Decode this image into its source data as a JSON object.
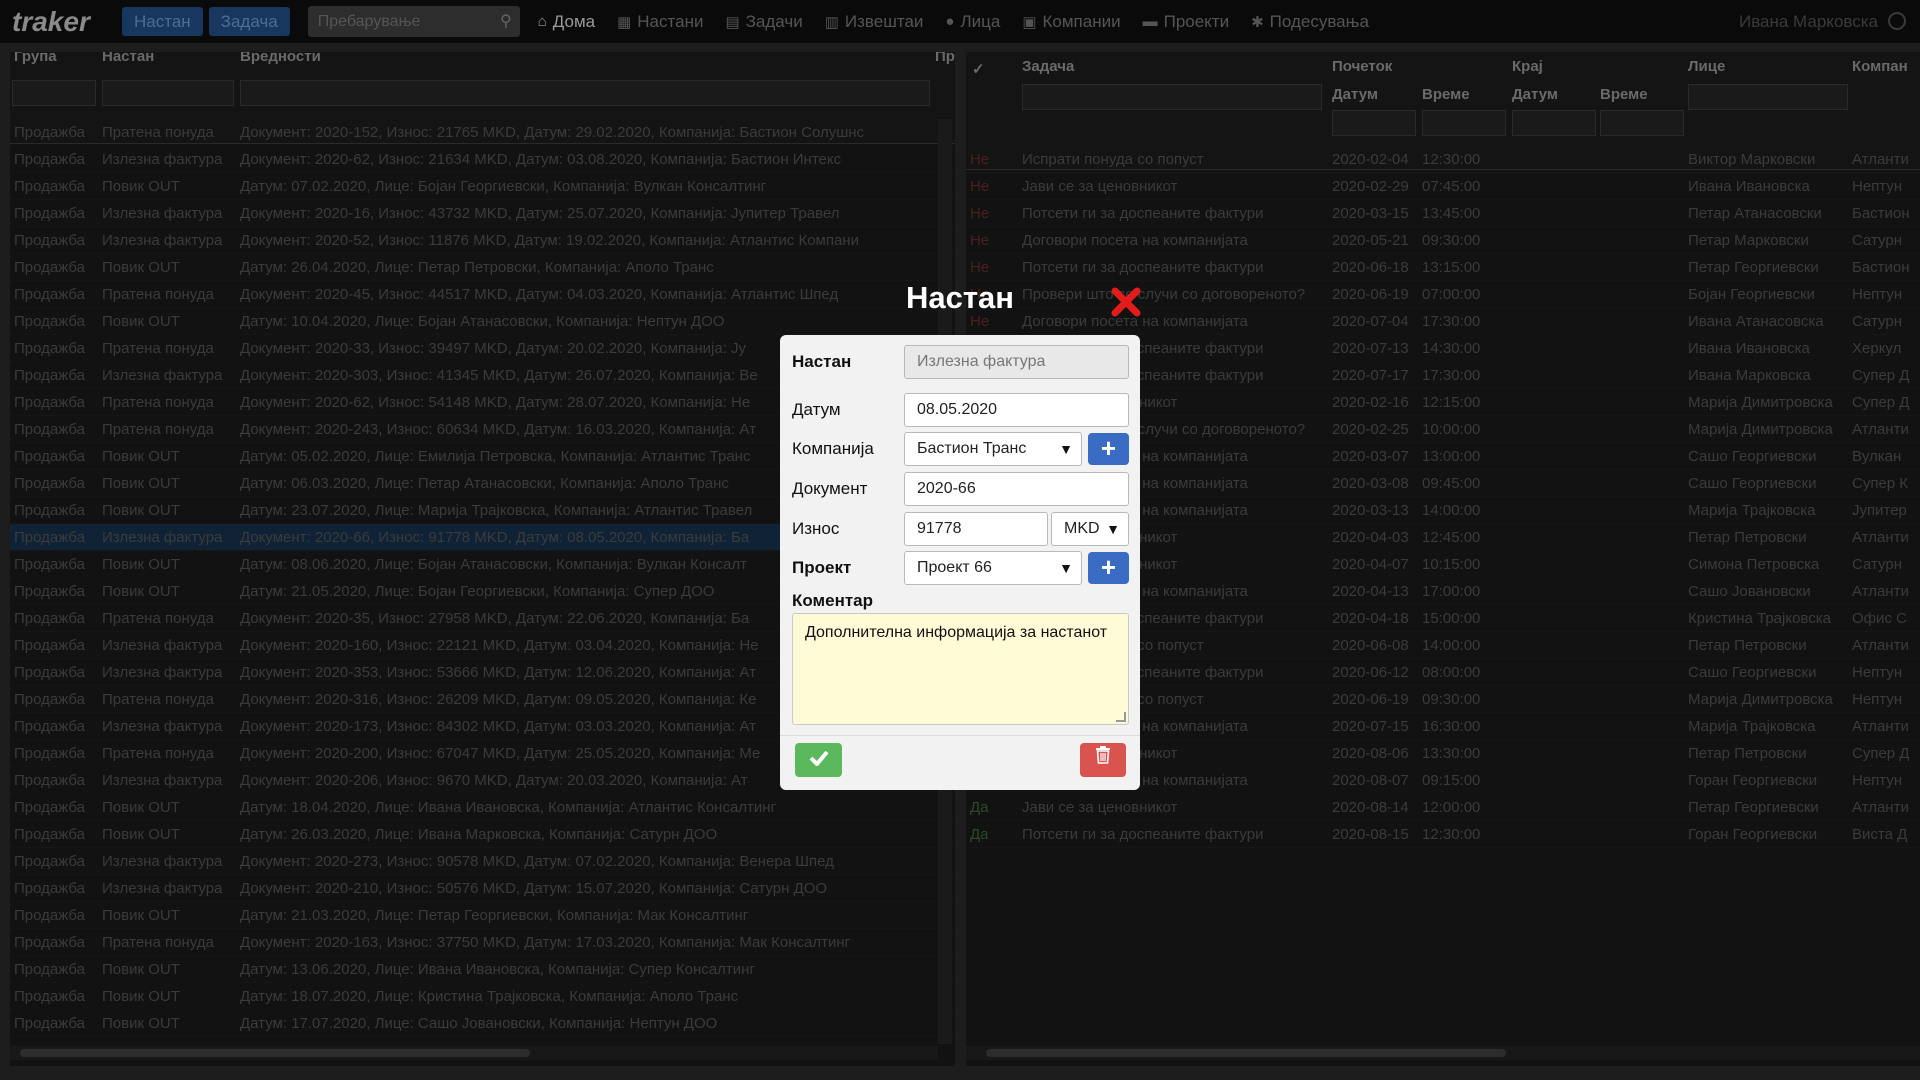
{
  "app": {
    "logo": "traker",
    "btn_nastan": "Настан",
    "btn_zadacha": "Задача",
    "search_placeholder": "Пребарување"
  },
  "nav": [
    {
      "label": "Дома",
      "icon": "home-icon",
      "active": true
    },
    {
      "label": "Настани",
      "icon": "calendar-icon"
    },
    {
      "label": "Задачи",
      "icon": "tasks-icon"
    },
    {
      "label": "Извештаи",
      "icon": "chart-icon"
    },
    {
      "label": "Лица",
      "icon": "person-icon"
    },
    {
      "label": "Компании",
      "icon": "building-icon"
    },
    {
      "label": "Проекти",
      "icon": "folder-icon"
    },
    {
      "label": "Подесувања",
      "icon": "gear-icon"
    }
  ],
  "user": "Ивана Марковска",
  "left": {
    "headers": {
      "group": "Група",
      "event": "Настан",
      "values": "Вредности",
      "pr": "Пр"
    },
    "rows": [
      [
        "Продажба",
        "Пратена понуда",
        "Документ: 2020-152, Износ: 21765 MKD, Датум: 29.02.2020, Компанија: Бастион Солушнс"
      ],
      [
        "Продажба",
        "Излезна фактура",
        "Документ: 2020-62, Износ: 21634 MKD, Датум: 03.08.2020, Компанија: Бастион Интекс"
      ],
      [
        "Продажба",
        "Повик OUT",
        "Датум: 07.02.2020, Лице: Бојан Георгиевски, Компанија: Вулкан Консалтинг"
      ],
      [
        "Продажба",
        "Излезна фактура",
        "Документ: 2020-16, Износ: 43732 MKD, Датум: 25.07.2020, Компанија: Јупитер Травел"
      ],
      [
        "Продажба",
        "Излезна фактура",
        "Документ: 2020-52, Износ: 11876 MKD, Датум: 19.02.2020, Компанија: Атлантис Компани"
      ],
      [
        "Продажба",
        "Повик OUT",
        "Датум: 26.04.2020, Лице: Петар Петровски, Компанија: Аполо Транс"
      ],
      [
        "Продажба",
        "Пратена понуда",
        "Документ: 2020-45, Износ: 44517 MKD, Датум: 04.03.2020, Компанија: Атлантис Шпед"
      ],
      [
        "Продажба",
        "Повик OUT",
        "Датум: 10.04.2020, Лице: Бојан Атанасовски, Компанија: Нептун ДОО"
      ],
      [
        "Продажба",
        "Пратена понуда",
        "Документ: 2020-33, Износ: 39497 MKD, Датум: 20.02.2020, Компанија: Ју"
      ],
      [
        "Продажба",
        "Излезна фактура",
        "Документ: 2020-303, Износ: 41345 MKD, Датум: 26.07.2020, Компанија: Ве"
      ],
      [
        "Продажба",
        "Пратена понуда",
        "Документ: 2020-62, Износ: 54148 MKD, Датум: 28.07.2020, Компанија: Не"
      ],
      [
        "Продажба",
        "Пратена понуда",
        "Документ: 2020-243, Износ: 60634 MKD, Датум: 16.03.2020, Компанија: Ат"
      ],
      [
        "Продажба",
        "Повик OUT",
        "Датум: 05.02.2020, Лице: Емилија Петровска, Компанија: Атлантис Транс"
      ],
      [
        "Продажба",
        "Повик OUT",
        "Датум: 06.03.2020, Лице: Петар Атанасовски, Компанија: Аполо Транс"
      ],
      [
        "Продажба",
        "Повик OUT",
        "Датум: 23.07.2020, Лице: Марија Трајковска, Компанија: Атлантис Травел"
      ],
      [
        "Продажба",
        "Излезна фактура",
        "Документ: 2020-66, Износ: 91778 MKD, Датум: 08.05.2020, Компанија: Ба"
      ],
      [
        "Продажба",
        "Повик OUT",
        "Датум: 08.06.2020, Лице: Бојан Атанасовски, Компанија: Вулкан Консалт"
      ],
      [
        "Продажба",
        "Повик OUT",
        "Датум: 21.05.2020, Лице: Бојан Георгиевски, Компанија: Супер ДОО"
      ],
      [
        "Продажба",
        "Пратена понуда",
        "Документ: 2020-35, Износ: 27958 MKD, Датум: 22.06.2020, Компанија: Ба"
      ],
      [
        "Продажба",
        "Излезна фактура",
        "Документ: 2020-160, Износ: 22121 MKD, Датум: 03.04.2020, Компанија: Не"
      ],
      [
        "Продажба",
        "Излезна фактура",
        "Документ: 2020-353, Износ: 53666 MKD, Датум: 12.06.2020, Компанија: Ат"
      ],
      [
        "Продажба",
        "Пратена понуда",
        "Документ: 2020-316, Износ: 26209 MKD, Датум: 09.05.2020, Компанија: Ке"
      ],
      [
        "Продажба",
        "Излезна фактура",
        "Документ: 2020-173, Износ: 84302 MKD, Датум: 03.03.2020, Компанија: Ат"
      ],
      [
        "Продажба",
        "Пратена понуда",
        "Документ: 2020-200, Износ: 67047 MKD, Датум: 25.05.2020, Компанија: Ме"
      ],
      [
        "Продажба",
        "Излезна фактура",
        "Документ: 2020-206, Износ: 9670 MKD, Датум: 20.03.2020, Компанија: Ат"
      ],
      [
        "Продажба",
        "Повик OUT",
        "Датум: 18.04.2020, Лице: Ивана Ивановска, Компанија: Атлантис Консалтинг"
      ],
      [
        "Продажба",
        "Повик OUT",
        "Датум: 26.03.2020, Лице: Ивана Марковска, Компанија: Сатурн ДОО"
      ],
      [
        "Продажба",
        "Излезна фактура",
        "Документ: 2020-273, Износ: 90578 MKD, Датум: 07.02.2020, Компанија: Венера Шпед"
      ],
      [
        "Продажба",
        "Излезна фактура",
        "Документ: 2020-210, Износ: 50576 MKD, Датум: 15.07.2020, Компанија: Сатурн ДОО"
      ],
      [
        "Продажба",
        "Повик OUT",
        "Датум: 21.03.2020, Лице: Петар Георгиевски, Компанија: Мак Консалтинг"
      ],
      [
        "Продажба",
        "Пратена понуда",
        "Документ: 2020-163, Износ: 37750 MKD, Датум: 17.03.2020, Компанија: Мак Консалтинг"
      ],
      [
        "Продажба",
        "Повик OUT",
        "Датум: 13.06.2020, Лице: Ивана Ивановска, Компанија: Супер Консалтинг"
      ],
      [
        "Продажба",
        "Повик OUT",
        "Датум: 18.07.2020, Лице: Кристина Трајковска, Компанија: Аполо Транс"
      ],
      [
        "Продажба",
        "Повик OUT",
        "Датум: 17.07.2020, Лице: Сашо Јовановски, Компанија: Нептун ДОО"
      ]
    ]
  },
  "right": {
    "headers": {
      "check": "✓",
      "task": "Задача",
      "start": "Почеток",
      "end": "Крај",
      "date": "Датум",
      "time": "Време",
      "person": "Лице",
      "company": "Компан"
    },
    "rows": [
      [
        "Не",
        "Испрати понуда со попуст",
        "2020-02-04",
        "12:30:00",
        "Виктор Марковски",
        "Атланти"
      ],
      [
        "Не",
        "Јави се за ценовникот",
        "2020-02-29",
        "07:45:00",
        "Ивана Ивановска",
        "Нептун"
      ],
      [
        "Не",
        "Потсети ги за доспеаните фактури",
        "2020-03-15",
        "13:45:00",
        "Петар Атанасовски",
        "Бастион"
      ],
      [
        "Не",
        "Договори посета на компанијата",
        "2020-05-21",
        "09:30:00",
        "Петар Марковски",
        "Сатурн"
      ],
      [
        "Не",
        "Потсети ги за доспеаните фактури",
        "2020-06-18",
        "13:15:00",
        "Петар Георгиевски",
        "Бастион"
      ],
      [
        "Не",
        "Провери што се случи со договореното?",
        "2020-06-19",
        "07:00:00",
        "Бојан Георгиевски",
        "Нептун"
      ],
      [
        "Не",
        "Договори посета на компанијата",
        "2020-07-04",
        "17:30:00",
        "Ивана Атанасовска",
        "Сатурн"
      ],
      [
        "Не",
        "Потсети ги за доспеаните фактури",
        "2020-07-13",
        "14:30:00",
        "Ивана Ивановска",
        "Херкул"
      ],
      [
        "Не",
        "Потсети ги за доспеаните фактури",
        "2020-07-17",
        "17:30:00",
        "Ивана Марковска",
        "Супер Д"
      ],
      [
        "Не",
        "Јави се за ценовникот",
        "2020-02-16",
        "12:15:00",
        "Марија Димитровска",
        "Супер Д"
      ],
      [
        "Не",
        "Провери што се случи со договореното?",
        "2020-02-25",
        "10:00:00",
        "Марија Димитровска",
        "Атланти"
      ],
      [
        "Не",
        "Договори посета на компанијата",
        "2020-03-07",
        "13:00:00",
        "Сашо Георгиевски",
        "Вулкан"
      ],
      [
        "Не",
        "Договори посета на компанијата",
        "2020-03-08",
        "09:45:00",
        "Сашо Георгиевски",
        "Супер К"
      ],
      [
        "Не",
        "Договори посета на компанијата",
        "2020-03-13",
        "14:00:00",
        "Марија Трајковска",
        "Јупитер"
      ],
      [
        "Не",
        "Јави се за ценовникот",
        "2020-04-03",
        "12:45:00",
        "Петар Петровски",
        "Атланти"
      ],
      [
        "Не",
        "Јави се за ценовникот",
        "2020-04-07",
        "10:15:00",
        "Симона Петровска",
        "Сатурн"
      ],
      [
        "Не",
        "Договори посета на компанијата",
        "2020-04-13",
        "17:00:00",
        "Сашо Јовановски",
        "Атланти"
      ],
      [
        "Не",
        "Потсети ги за доспеаните фактури",
        "2020-04-18",
        "15:00:00",
        "Кристина Трајковска",
        "Офис С"
      ],
      [
        "Не",
        "Испрати понуда со попуст",
        "2020-06-08",
        "14:00:00",
        "Петар Петровски",
        "Атланти"
      ],
      [
        "Не",
        "Потсети ги за доспеаните фактури",
        "2020-06-12",
        "08:00:00",
        "Сашо Георгиевски",
        "Нептун"
      ],
      [
        "Не",
        "Испрати понуда со попуст",
        "2020-06-19",
        "09:30:00",
        "Марија Димитровска",
        "Нептун"
      ],
      [
        "Не",
        "Договори посета на компанијата",
        "2020-07-15",
        "16:30:00",
        "Марија Трајковска",
        "Атланти"
      ],
      [
        "Не",
        "Јави се за ценовникот",
        "2020-08-06",
        "13:30:00",
        "Петар Петровски",
        "Супер Д"
      ],
      [
        "Не",
        "Договори посета на компанијата",
        "2020-08-07",
        "09:15:00",
        "Горан Георгиевски",
        "Нептун"
      ],
      [
        "Да",
        "Јави се за ценовникот",
        "2020-08-14",
        "12:00:00",
        "Петар Георгиевски",
        "Атланти"
      ],
      [
        "Да",
        "Потсети ги за доспеаните фактури",
        "2020-08-15",
        "12:30:00",
        "Горан Георгиевски",
        "Виста Д"
      ]
    ]
  },
  "modal": {
    "title": "Настан",
    "labels": {
      "event": "Настан",
      "date": "Датум",
      "company": "Компанија",
      "document": "Документ",
      "amount": "Износ",
      "project": "Проект",
      "comment": "Коментар"
    },
    "values": {
      "event": "Излезна фактура",
      "date": "08.05.2020",
      "company": "Бастион Транс",
      "document": "2020-66",
      "amount": "91778",
      "currency": "MKD",
      "project": "Проект 66",
      "comment": "Дополнителна информација за настанот"
    }
  },
  "colors": {
    "ok": "#5cb85c",
    "delete": "#d9534f",
    "plus": "#3b6cc4",
    "comment_bg": "#fffbd6"
  }
}
